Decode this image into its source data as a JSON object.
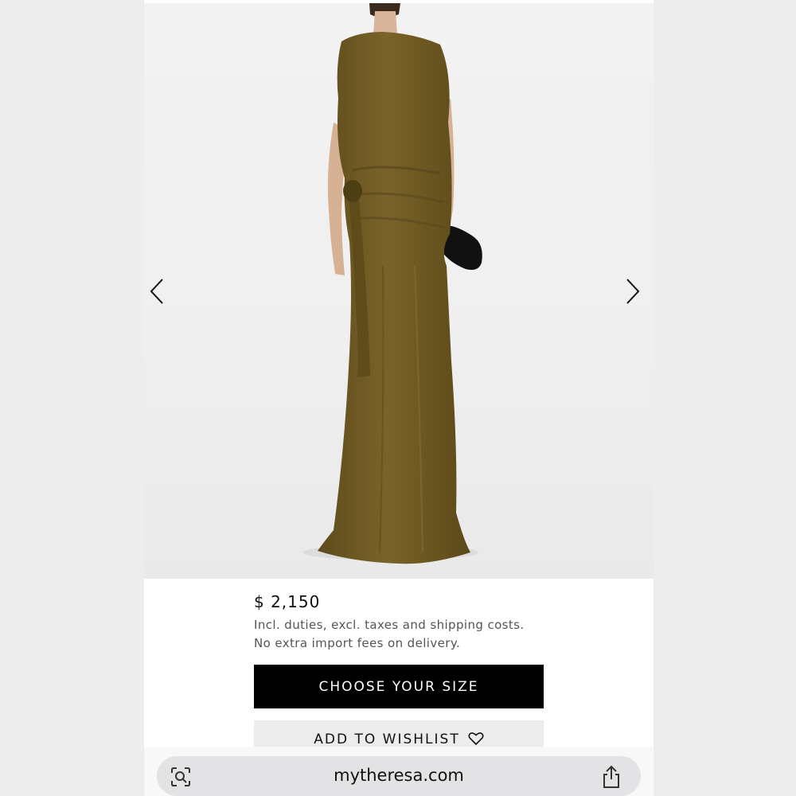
{
  "product": {
    "price": "$ 2,150",
    "duties_note": "Incl. duties, excl. taxes and shipping costs.",
    "import_note": "No extra import fees on delivery.",
    "dress_color": "#6f5a24"
  },
  "actions": {
    "choose_size": "CHOOSE YOUR SIZE",
    "add_to_wishlist": "ADD TO WISHLIST"
  },
  "gallery": {
    "prev_icon": "chevron-left-icon",
    "next_icon": "chevron-right-icon"
  },
  "browser": {
    "url": "mytheresa.com",
    "left_icon": "visual-lookup-icon",
    "right_icon": "share-icon"
  }
}
